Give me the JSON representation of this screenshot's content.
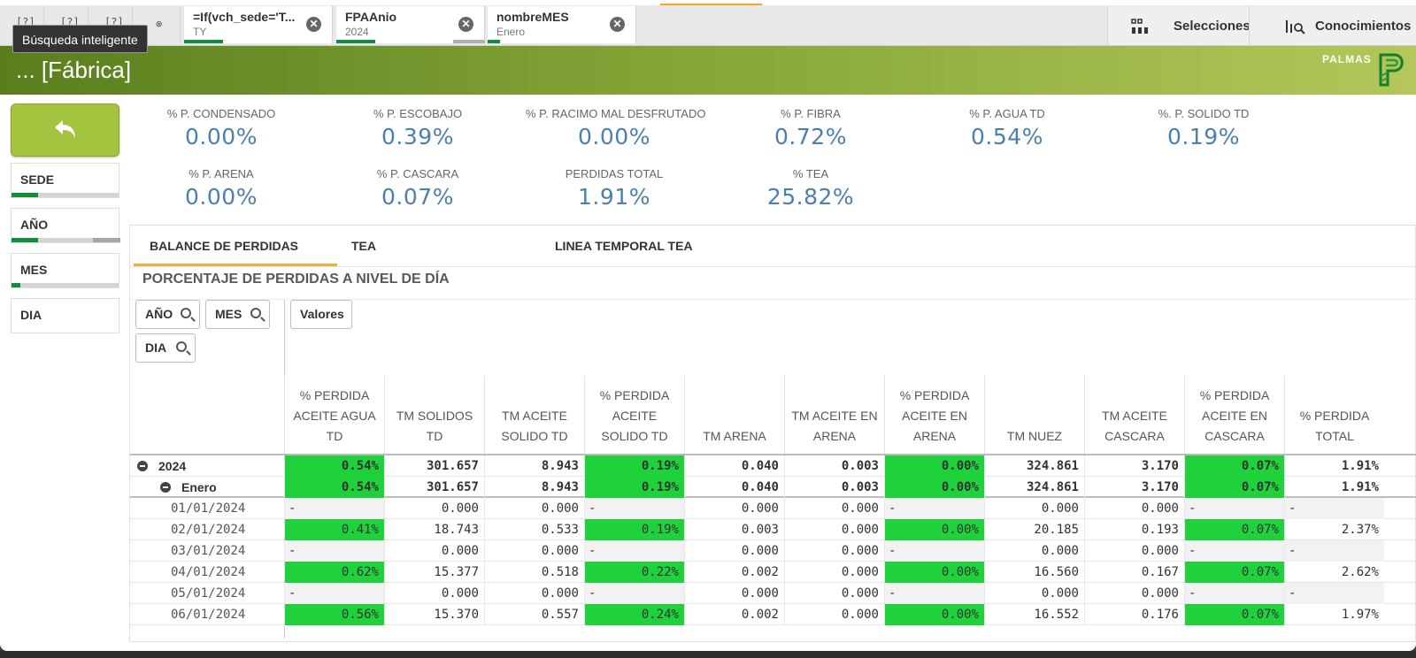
{
  "selection_bar": {
    "nav_stubs": [
      "[?]",
      "[?]",
      "[?]"
    ],
    "chips": [
      {
        "title": "=If(vch_sede='T...",
        "value": "TY"
      },
      {
        "title": "FPAAnio",
        "value": "2024"
      },
      {
        "title": "nombreMES",
        "value": "Enero"
      }
    ],
    "tooltip": "Búsqueda inteligente",
    "selections_label": "Selecciones",
    "insights_label": "Conocimientos"
  },
  "header": {
    "title": "... [Fábrica]",
    "brand": "PALMAS"
  },
  "filters": [
    "SEDE",
    "AÑO",
    "MES",
    "DIA"
  ],
  "kpis": [
    {
      "label": "% P. CONDENSADO",
      "value": "0.00%"
    },
    {
      "label": "% P. ESCOBAJO",
      "value": "0.39%"
    },
    {
      "label": "% P. RACIMO MAL DESFRUTADO",
      "value": "0.00%"
    },
    {
      "label": "% P. FIBRA",
      "value": "0.72%"
    },
    {
      "label": "% P. AGUA TD",
      "value": "0.54%"
    },
    {
      "label": "%. P. SOLIDO TD",
      "value": "0.19%"
    },
    {
      "label": "% P. ARENA",
      "value": "0.00%"
    },
    {
      "label": "% P. CASCARA",
      "value": "0.07%"
    },
    {
      "label": "PERDIDAS TOTAL",
      "value": "1.91%"
    },
    {
      "label": "% TEA",
      "value": "25.82%"
    }
  ],
  "tabs": [
    "BALANCE DE PERDIDAS",
    "TEA",
    "LINEA TEMPORAL TEA"
  ],
  "panel_title": "PORCENTAJE DE PERDIDAS A NIVEL DE DÍA",
  "dimension_buttons": [
    "AÑO",
    "MES",
    "DIA"
  ],
  "values_button": "Valores",
  "table": {
    "columns": [
      "% PERDIDA ACEITE AGUA TD",
      "TM SOLIDOS TD",
      "TM ACEITE SOLIDO TD",
      "% PERDIDA ACEITE SOLIDO TD",
      "TM ARENA",
      "TM ACEITE EN ARENA",
      "% PERDIDA ACEITE EN ARENA",
      "TM NUEZ",
      "TM ACEITE CASCARA",
      "% PERDIDA ACEITE EN CASCARA",
      "% PERDIDA TOTAL"
    ],
    "rows": [
      {
        "label": "2024",
        "kind": "year",
        "cells": [
          "0.54%",
          "301.657",
          "8.943",
          "0.19%",
          "0.040",
          "0.003",
          "0.00%",
          "324.861",
          "3.170",
          "0.07%",
          "1.91%"
        ]
      },
      {
        "label": "Enero",
        "kind": "month",
        "cells": [
          "0.54%",
          "301.657",
          "8.943",
          "0.19%",
          "0.040",
          "0.003",
          "0.00%",
          "324.861",
          "3.170",
          "0.07%",
          "1.91%"
        ]
      },
      {
        "label": "01/01/2024",
        "kind": "date",
        "cells": [
          "-",
          "0.000",
          "0.000",
          "-",
          "0.000",
          "0.000",
          "-",
          "0.000",
          "0.000",
          "-",
          "-"
        ]
      },
      {
        "label": "02/01/2024",
        "kind": "date",
        "cells": [
          "0.41%",
          "18.743",
          "0.533",
          "0.19%",
          "0.003",
          "0.000",
          "0.00%",
          "20.185",
          "0.193",
          "0.07%",
          "2.37%"
        ]
      },
      {
        "label": "03/01/2024",
        "kind": "date",
        "cells": [
          "-",
          "0.000",
          "0.000",
          "-",
          "0.000",
          "0.000",
          "-",
          "0.000",
          "0.000",
          "-",
          "-"
        ]
      },
      {
        "label": "04/01/2024",
        "kind": "date",
        "cells": [
          "0.62%",
          "15.377",
          "0.518",
          "0.22%",
          "0.002",
          "0.000",
          "0.00%",
          "16.560",
          "0.167",
          "0.07%",
          "2.62%"
        ]
      },
      {
        "label": "05/01/2024",
        "kind": "date",
        "cells": [
          "-",
          "0.000",
          "0.000",
          "-",
          "0.000",
          "0.000",
          "-",
          "0.000",
          "0.000",
          "-",
          "-"
        ]
      },
      {
        "label": "06/01/2024",
        "kind": "date",
        "cells": [
          "0.56%",
          "15.370",
          "0.557",
          "0.24%",
          "0.002",
          "0.000",
          "0.00%",
          "16.552",
          "0.176",
          "0.07%",
          "1.97%"
        ]
      }
    ]
  },
  "colors": {
    "highlight_green": "#1fd23b",
    "kpi_value": "#4a7fb0",
    "band_start": "#5a7e1e",
    "band_end": "#b3c75a",
    "back_button": "#a4c33e",
    "selection_green": "#0f8f3c"
  }
}
